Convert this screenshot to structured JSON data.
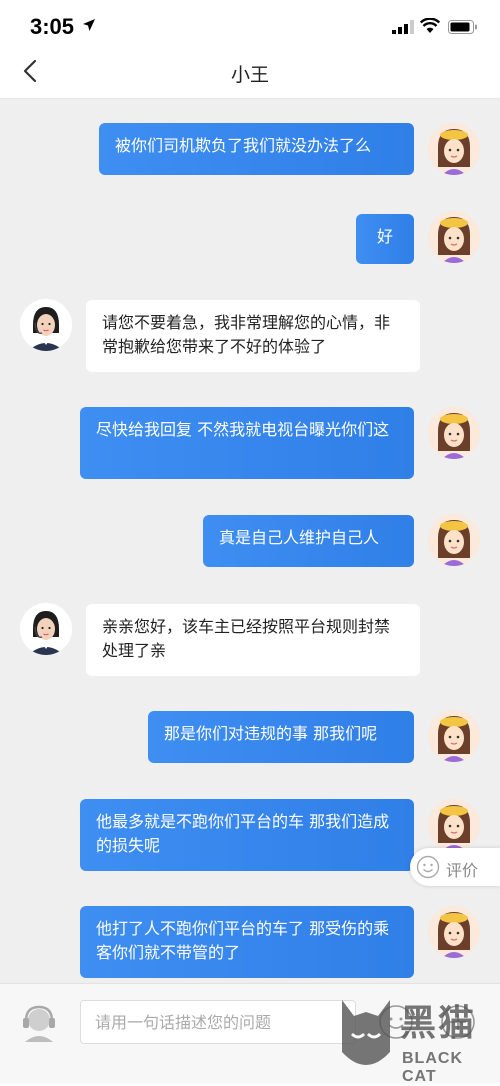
{
  "status_bar": {
    "time": "3:05"
  },
  "nav": {
    "title": "小王"
  },
  "messages": [
    {
      "side": "out",
      "text": "被你们司机欺负了我们就没办法了么"
    },
    {
      "side": "out",
      "text": "好"
    },
    {
      "side": "in",
      "text": "请您不要着急，我非常理解您的心情，非常抱歉给您带来了不好的体验了"
    },
    {
      "side": "out",
      "text": "尽快给我回复 不然我就电视台曝光你们这"
    },
    {
      "side": "out",
      "text": "真是自己人维护自己人"
    },
    {
      "side": "in",
      "text": "亲亲您好，该车主已经按照平台规则封禁处理了亲"
    },
    {
      "side": "out",
      "text": "那是你们对违规的事 那我们呢"
    },
    {
      "side": "out",
      "text": "他最多就是不跑你们平台的车 那我们造成的损失呢"
    },
    {
      "side": "out",
      "text": "他打了人不跑你们平台的车了 那受伤的乘客你们就不带管的了"
    }
  ],
  "rate": {
    "label": "评价"
  },
  "input": {
    "placeholder": "请用一句话描述您的问题",
    "value": ""
  },
  "watermark": {
    "cn": "黑猫",
    "en": "BLACK CAT"
  },
  "colors": {
    "bubble_out": "#3f8ef2",
    "bubble_in": "#ffffff",
    "chat_bg": "#efefef"
  }
}
